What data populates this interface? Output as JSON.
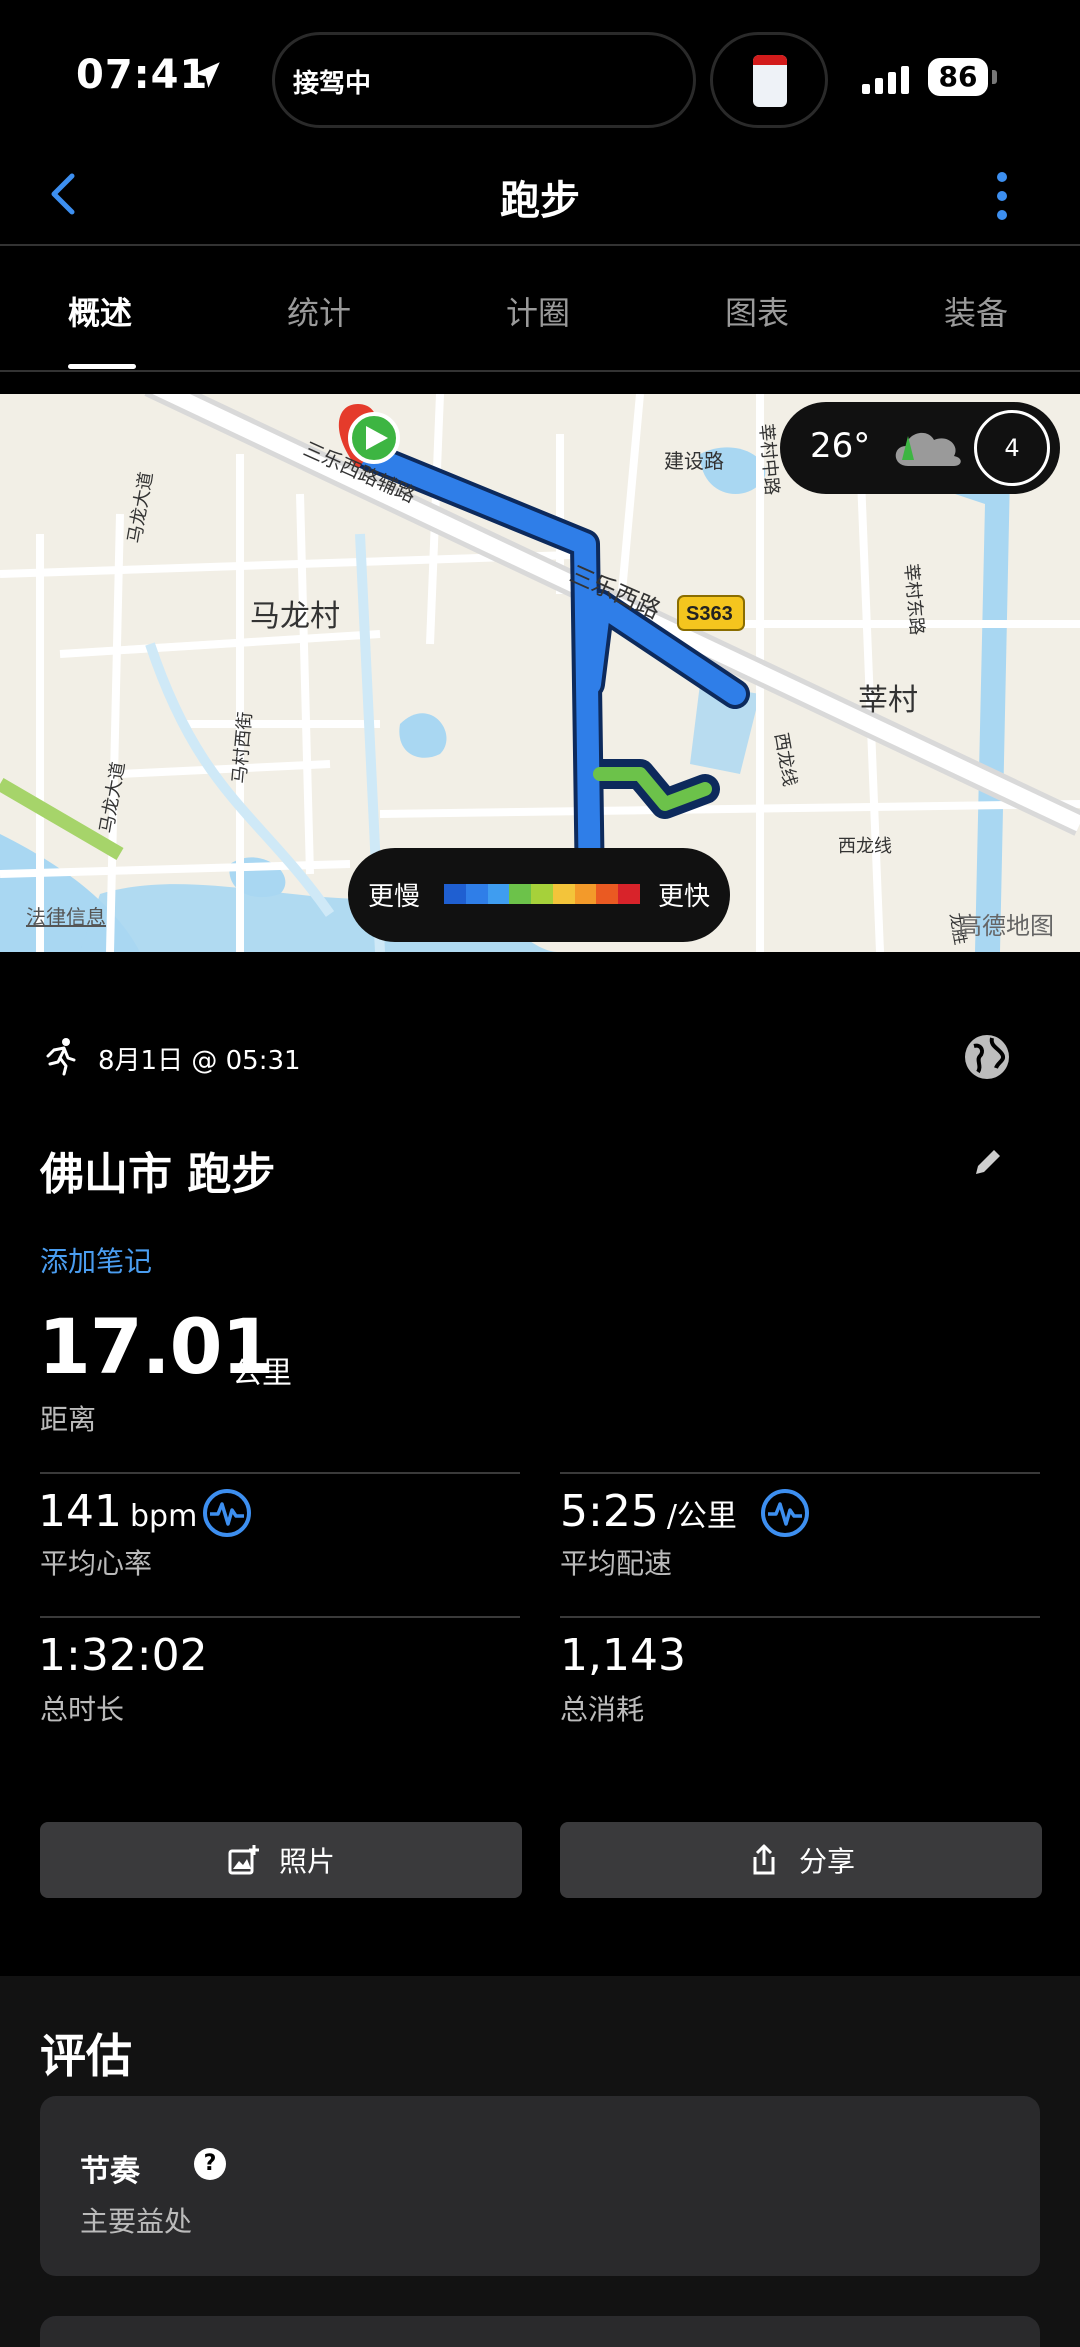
{
  "status_bar": {
    "time": "07:41",
    "island_text": "接驾中",
    "battery": "86"
  },
  "nav": {
    "title": "跑步"
  },
  "tabs": [
    {
      "label": "概述",
      "active": true
    },
    {
      "label": "统计",
      "active": false
    },
    {
      "label": "计圈",
      "active": false
    },
    {
      "label": "图表",
      "active": false
    },
    {
      "label": "装备",
      "active": false
    }
  ],
  "map": {
    "labels": {
      "road1": "三乐西路辅路",
      "road2": "建设路",
      "road3": "三乐西路",
      "village1": "马龙村",
      "village2": "莘村",
      "highway": "S363",
      "road4": "马龙大道",
      "road5": "马村西街",
      "road6": "西龙线",
      "road7": "莘村东路",
      "road8": "莘村中路",
      "road9": "马龙大道",
      "road10": "西龙线",
      "road11": "龙胜",
      "legal": "法律信息",
      "brand": "高德地图"
    },
    "weather": {
      "temp": "26°",
      "wind": "4"
    },
    "legend": {
      "slow": "更慢",
      "fast": "更快",
      "colors": [
        "#1f5fd1",
        "#2f7ee8",
        "#3f9df0",
        "#6cc24a",
        "#a6d13a",
        "#f3c43a",
        "#f39a2a",
        "#ea5a22",
        "#d8232a"
      ]
    }
  },
  "activity": {
    "date": "8月1日 @ 05:31",
    "title": "佛山市 跑步",
    "add_note": "添加笔记",
    "distance": "17.01",
    "distance_unit": "公里",
    "distance_label": "距离"
  },
  "stats": {
    "hr_value": "141",
    "hr_unit": "bpm",
    "hr_label": "平均心率",
    "pace_value": "5:25",
    "pace_unit": "/公里",
    "pace_label": "平均配速",
    "duration_value": "1:32:02",
    "duration_label": "总时长",
    "calories_value": "1,143",
    "calories_label": "总消耗"
  },
  "buttons": {
    "photos": "照片",
    "share": "分享"
  },
  "evaluation": {
    "title": "评估",
    "card_title": "节奏",
    "card_sub": "主要益处"
  },
  "colors": {
    "accent": "#4a9df0",
    "background": "#000000",
    "card": "#2a2a2c"
  }
}
